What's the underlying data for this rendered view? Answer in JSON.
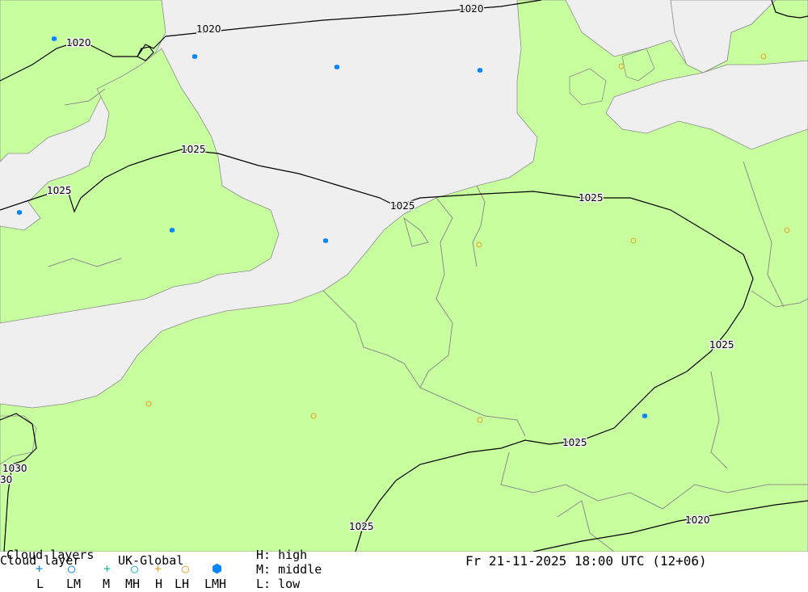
{
  "colors": {
    "sea": "#efefef",
    "land": "#c8ff9e",
    "border": "#8c8c8c",
    "isobar": "#000000",
    "symbol_lmh": "#0a84ff",
    "symbol_h": "#e8a020",
    "symbol_m": "#18b4a0"
  },
  "map": {
    "isobar_labels": [
      "1020",
      "1020",
      "1020",
      "1025",
      "1025",
      "1025",
      "1025",
      "1025",
      "1025",
      "1025",
      "1030",
      "30",
      "1020"
    ]
  },
  "station_symbols": {
    "lmh_count": 9,
    "lh_count": 10
  },
  "legend": {
    "title_left": "Cloud layers",
    "title_overlap": "Cloud layer",
    "model": "UK-Global",
    "codes": [
      "L",
      "LM",
      "M",
      "MH",
      "H",
      "LH",
      "LMH"
    ],
    "key_high": "H: high",
    "key_middle": "M: middle",
    "key_low": "L: low",
    "datetime": "Fr 21-11-2025 18:00 UTC (12+06)"
  }
}
